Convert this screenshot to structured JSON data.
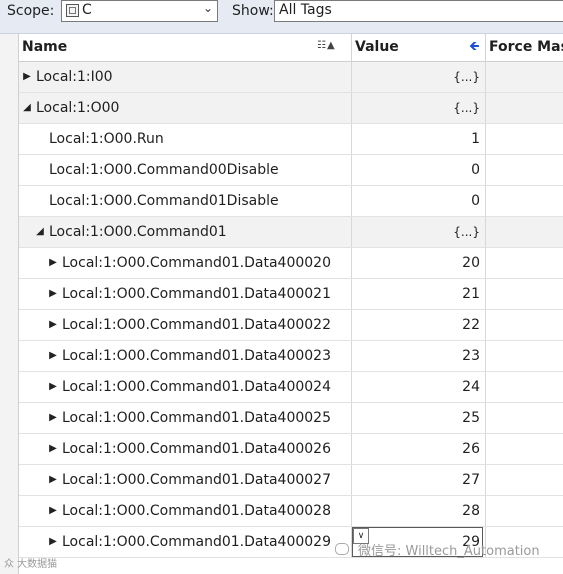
{
  "toolbar": {
    "scope_label": "Scope:",
    "scope_value": "C",
    "show_label": "Show:",
    "show_value": "All Tags"
  },
  "columns": {
    "name": "Name",
    "value": "Value",
    "force_mask": "Force Mask"
  },
  "rows": [
    {
      "name": "Local:1:I00",
      "value": "{...}",
      "toggle": "▶",
      "shade": true
    },
    {
      "name": "Local:1:O00",
      "value": "{...}",
      "toggle": "◢",
      "shade": true
    },
    {
      "name": "Local:1:O00.Run",
      "value": "1",
      "toggle": "",
      "shade": false
    },
    {
      "name": "Local:1:O00.Command00Disable",
      "value": "0",
      "toggle": "",
      "shade": false
    },
    {
      "name": "Local:1:O00.Command01Disable",
      "value": "0",
      "toggle": "",
      "shade": false
    },
    {
      "name": "Local:1:O00.Command01",
      "value": "{...}",
      "toggle": "◢",
      "shade": true
    },
    {
      "name": "Local:1:O00.Command01.Data400020",
      "value": "20",
      "toggle": "▶",
      "shade": false
    },
    {
      "name": "Local:1:O00.Command01.Data400021",
      "value": "21",
      "toggle": "▶",
      "shade": false
    },
    {
      "name": "Local:1:O00.Command01.Data400022",
      "value": "22",
      "toggle": "▶",
      "shade": false
    },
    {
      "name": "Local:1:O00.Command01.Data400023",
      "value": "23",
      "toggle": "▶",
      "shade": false
    },
    {
      "name": "Local:1:O00.Command01.Data400024",
      "value": "24",
      "toggle": "▶",
      "shade": false
    },
    {
      "name": "Local:1:O00.Command01.Data400025",
      "value": "25",
      "toggle": "▶",
      "shade": false
    },
    {
      "name": "Local:1:O00.Command01.Data400026",
      "value": "26",
      "toggle": "▶",
      "shade": false
    },
    {
      "name": "Local:1:O00.Command01.Data400027",
      "value": "27",
      "toggle": "▶",
      "shade": false
    },
    {
      "name": "Local:1:O00.Command01.Data400028",
      "value": "28",
      "toggle": "▶",
      "shade": false
    },
    {
      "name": "Local:1:O00.Command01.Data400029",
      "value": "29",
      "toggle": "▶",
      "shade": false
    }
  ],
  "watermark": {
    "left_text": "众 大数据猫",
    "right_text": "微信号: Willtech_Automation"
  },
  "colors": {
    "toolbar_bg": "#e6ebf3",
    "row_shade": "#f2f2f2",
    "value_sort_arrow": "#1a4fd6"
  }
}
